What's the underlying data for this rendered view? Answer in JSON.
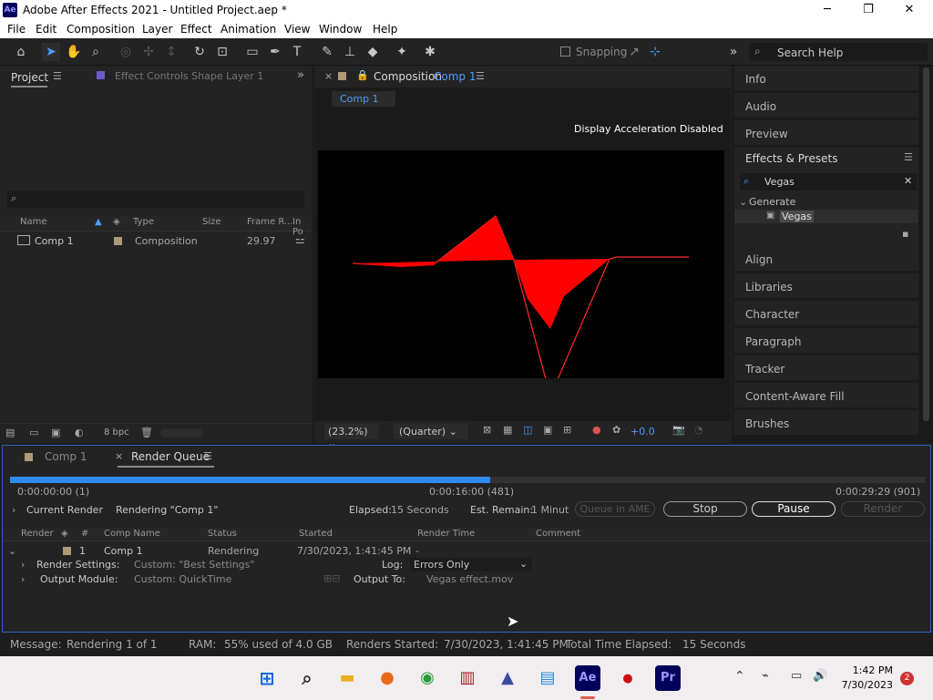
{
  "window": {
    "title": "Adobe After Effects 2021 - Untitled Project.aep *",
    "app_badge": "Ae",
    "minimize": "─",
    "maximize": "❐",
    "close": "✕"
  },
  "menu": [
    "File",
    "Edit",
    "Composition",
    "Layer",
    "Effect",
    "Animation",
    "View",
    "Window",
    "Help"
  ],
  "toolbar": {
    "snapping": "Snapping",
    "search_help": "Search Help",
    "overflow": "»"
  },
  "project_panel": {
    "tab_project": "Project",
    "tab_effect_controls": "Effect Controls Shape Layer 1",
    "search_placeholder": "",
    "columns": {
      "name": "Name",
      "type": "Type",
      "size": "Size",
      "frame_rate": "Frame R...",
      "in_point": "In Po"
    },
    "items": [
      {
        "name": "Comp 1",
        "type": "Composition",
        "frame_rate": "29.97"
      }
    ],
    "bpc": "8 bpc"
  },
  "composition_panel": {
    "tab_label": "Composition",
    "tab_comp": "Comp 1",
    "sub_tab": "Comp 1",
    "notice": "Display Acceleration Disabled",
    "zoom": "(23.2%)",
    "resolution": "(Quarter)",
    "exposure": "+0.0",
    "shape_color": "#ff0000"
  },
  "right_panels": {
    "info": "Info",
    "audio": "Audio",
    "preview": "Preview",
    "effects_presets": "Effects & Presets",
    "search_value": "Vegas",
    "category": "Generate",
    "effect_item": "Vegas",
    "align": "Align",
    "libraries": "Libraries",
    "character": "Character",
    "paragraph": "Paragraph",
    "tracker": "Tracker",
    "content_aware_fill": "Content-Aware Fill",
    "brushes": "Brushes"
  },
  "render_queue": {
    "tab_comp": "Comp 1",
    "tab_render_queue": "Render Queue",
    "progress": 0.525,
    "time_start": "0:00:00:00 (1)",
    "time_current": "0:00:16:00 (481)",
    "time_end": "0:00:29:29 (901)",
    "current_render_label": "Current Render",
    "rendering_text": "Rendering \"Comp 1\"",
    "elapsed_label": "Elapsed:",
    "elapsed_value": "15 Seconds",
    "remain_label": "Est. Remain:",
    "remain_value": "1 Minut",
    "queue_ame": "Queue in AME",
    "stop": "Stop",
    "pause": "Pause",
    "render": "Render",
    "columns": {
      "render": "Render",
      "num": "#",
      "comp_name": "Comp Name",
      "status": "Status",
      "started": "Started",
      "render_time": "Render Time",
      "comment": "Comment"
    },
    "item": {
      "num": "1",
      "comp_name": "Comp 1",
      "status": "Rendering",
      "started": "7/30/2023, 1:41:45 PM",
      "render_time": "-",
      "render_settings_label": "Render Settings:",
      "render_settings_value": "Custom: \"Best Settings\"",
      "log_label": "Log:",
      "log_value": "Errors Only",
      "output_module_label": "Output Module:",
      "output_module_value": "Custom: QuickTime",
      "output_to_label": "Output To:",
      "output_to_value": "Vegas effect.mov"
    }
  },
  "status_bar": {
    "message_label": "Message:",
    "message_value": "Rendering 1 of 1",
    "ram_label": "RAM:",
    "ram_value": "55% used of 4.0 GB",
    "renders_started_label": "Renders Started:",
    "renders_started_value": "7/30/2023, 1:41:45 PM",
    "total_label": "Total Time Elapsed:",
    "total_value": "15 Seconds"
  },
  "taskbar": {
    "time": "1:42 PM",
    "date": "7/30/2023",
    "notifications": "2",
    "ae": "Ae",
    "pr": "Pr"
  }
}
